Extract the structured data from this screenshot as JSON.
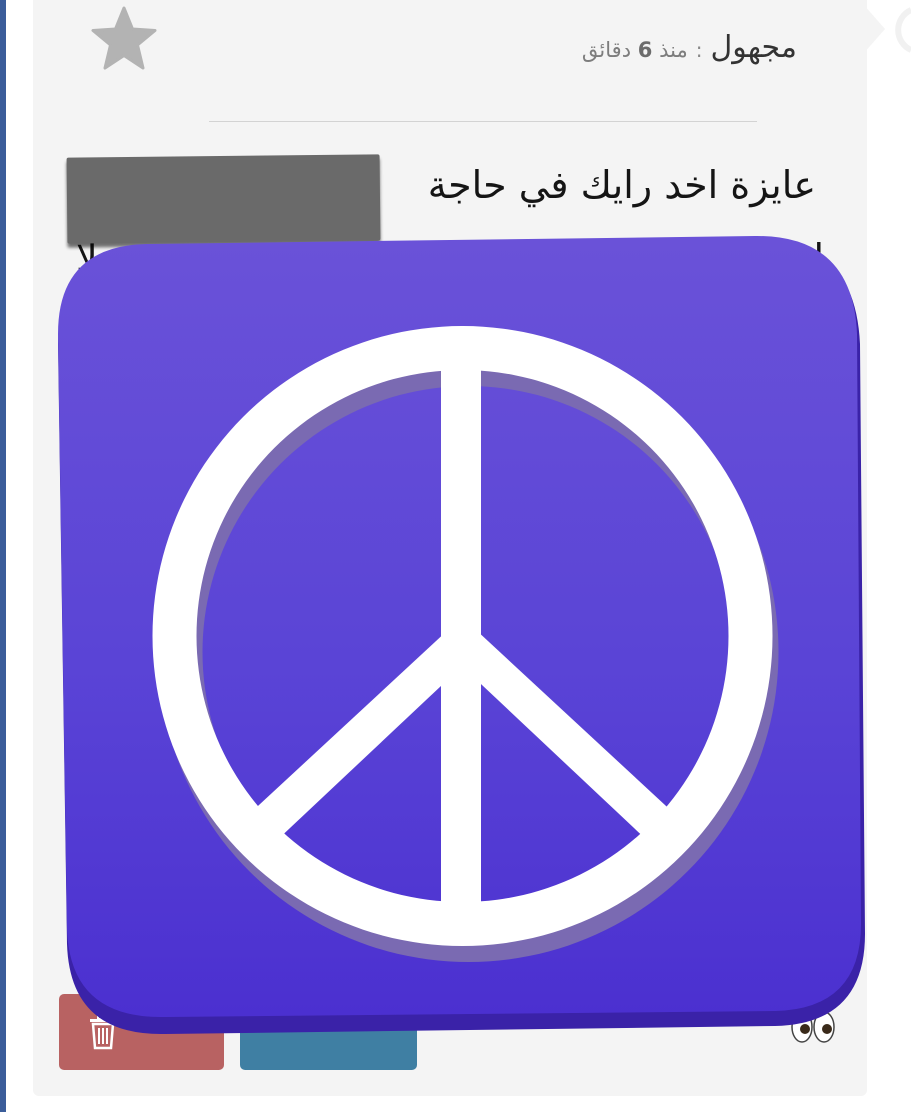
{
  "post": {
    "author": "مجهول",
    "separator": ":",
    "time_prefix": "منذ",
    "time_value": "6",
    "time_unit": "دقائق",
    "line1": "عايزة اخد رايك في حاجة",
    "line2_right_fragment": "ا",
    "line2_left_fragment": "لا"
  },
  "colors": {
    "sidebar_rule": "#3b5d9a",
    "card_bg": "#f4f4f4",
    "delete_button": "#b86262",
    "reply_button": "#3f7fa3",
    "sticker_purple": "#5a3fd6",
    "redaction": "#6a6a6a"
  },
  "icons": {
    "favorite": "star-icon",
    "delete": "trash-icon",
    "emoji": "eyes-emoji-icon",
    "sticker": "peace-sign-sticker"
  }
}
